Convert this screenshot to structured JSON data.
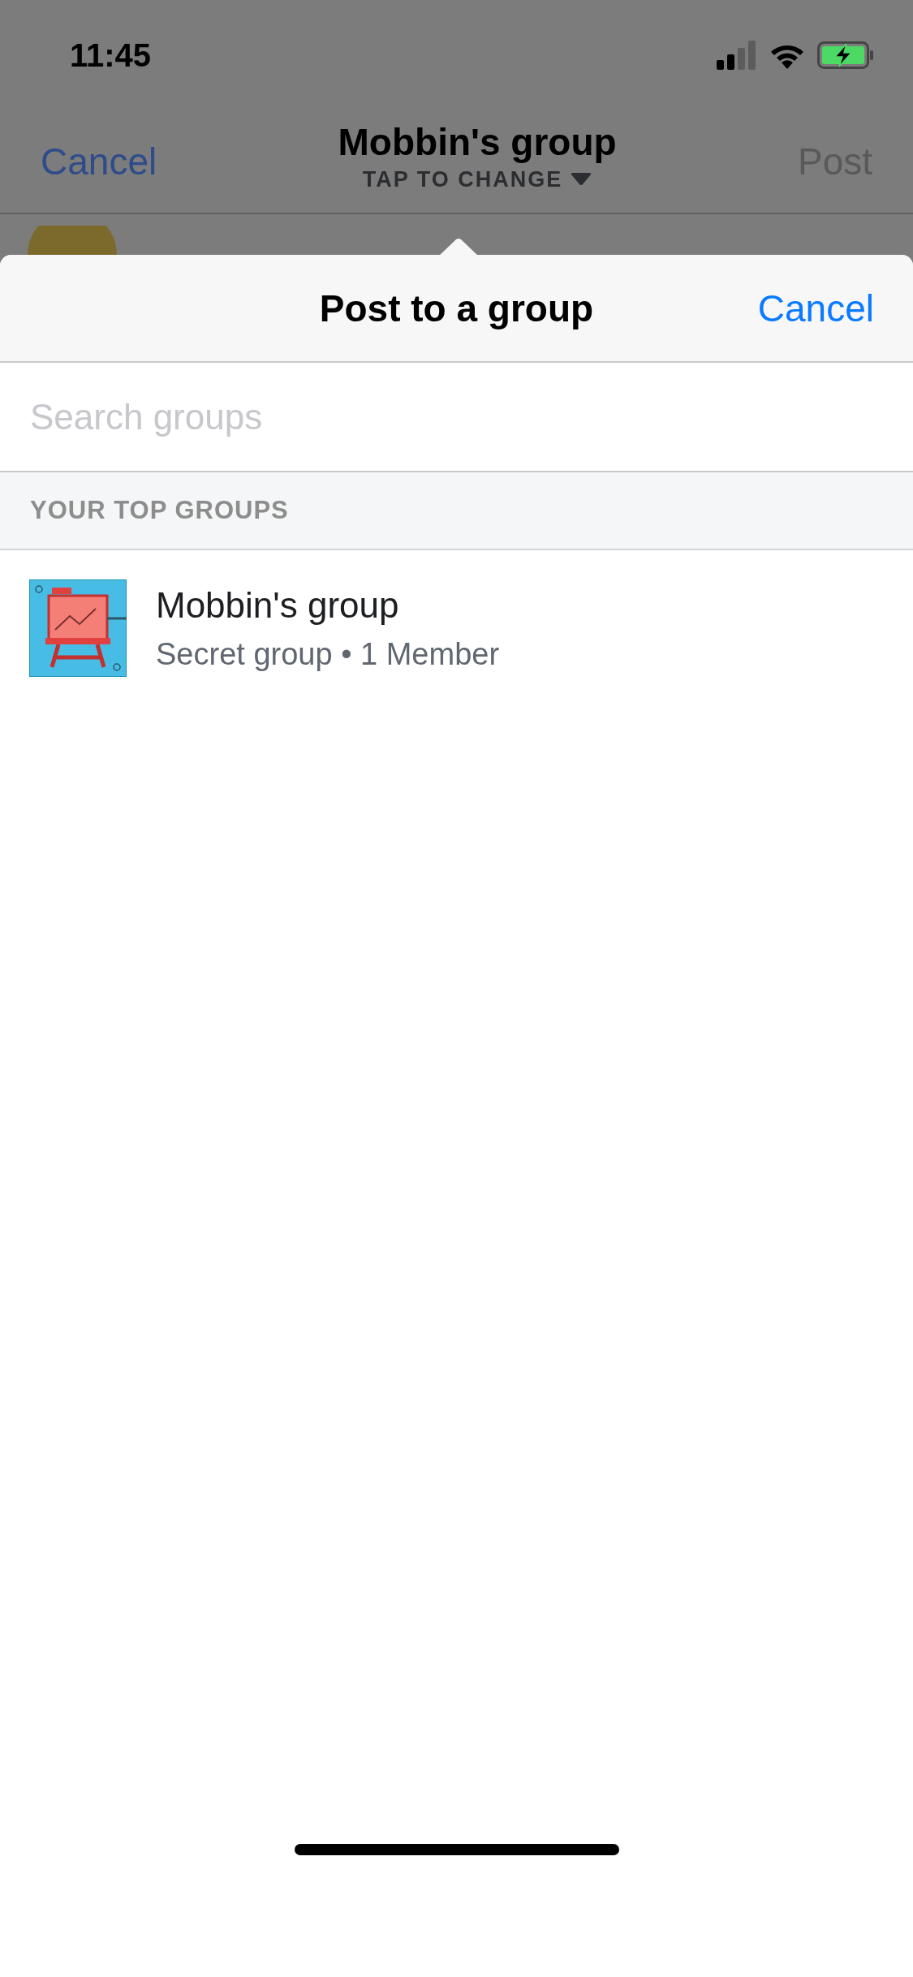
{
  "status_bar": {
    "time": "11:45"
  },
  "nav_bar": {
    "left_button": "Cancel",
    "title": "Mobbin's group",
    "subtitle": "TAP TO CHANGE",
    "right_button": "Post",
    "right_disabled": true
  },
  "sheet": {
    "title": "Post to a group",
    "cancel": "Cancel",
    "search": {
      "placeholder": "Search groups"
    },
    "section_header": "YOUR TOP GROUPS",
    "groups": [
      {
        "name": "Mobbin's group",
        "details": "Secret group • 1 Member"
      }
    ]
  }
}
